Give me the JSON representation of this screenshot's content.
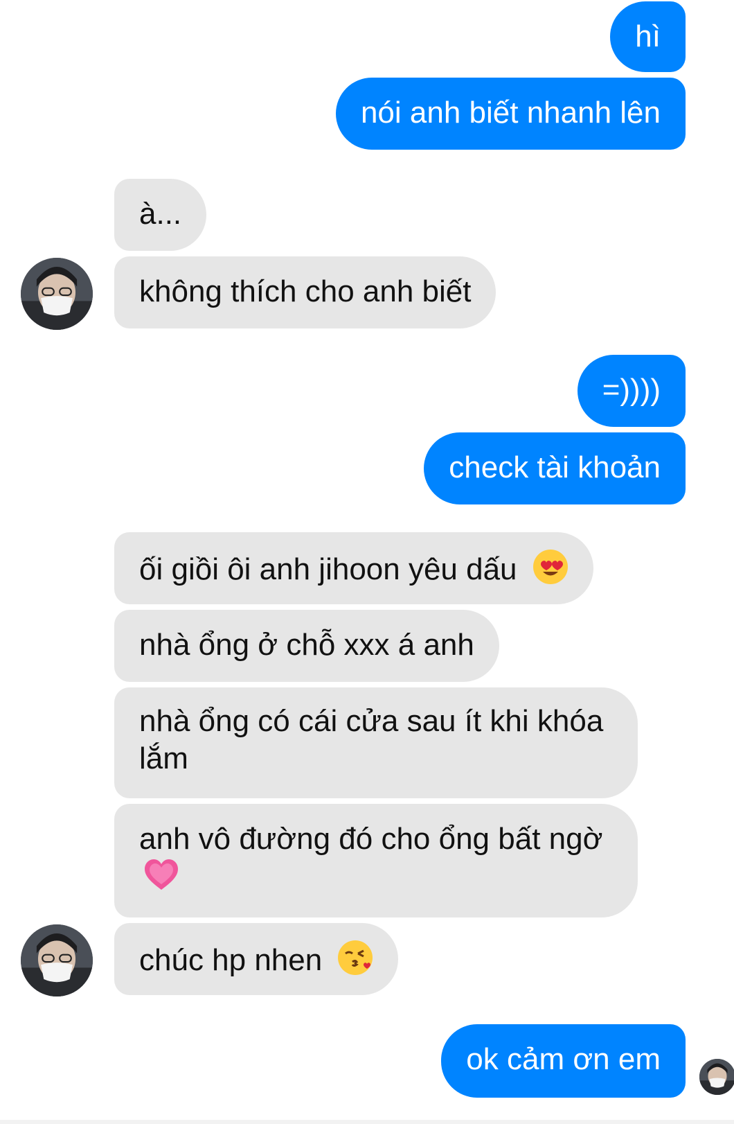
{
  "messages": {
    "m1": "hì",
    "m2": "nói anh biết nhanh lên",
    "m3": "à...",
    "m4": "không thích cho anh biết",
    "m5": "=))))",
    "m6": "check tài khoản",
    "m7": "ối giồi ôi anh jihoon yêu dấu",
    "m8": "nhà ổng ở chỗ xxx á anh",
    "m9": "nhà ổng có cái cửa sau ít khi khóa lắm",
    "m10": "anh vô đường đó cho ổng bất ngờ",
    "m11": "chúc hp nhen",
    "m12": "ok cảm ơn em"
  },
  "icons": {
    "m7": "heart-eyes-emoji",
    "m10": "pink-heart-emoji",
    "m11": "kiss-wink-emoji",
    "contact_avatar": "masked-person-avatar",
    "seen_avatar": "masked-person-avatar"
  },
  "colors": {
    "outgoing_bubble": "#0084ff",
    "incoming_bubble": "#e6e6e6",
    "outgoing_text": "#ffffff",
    "incoming_text": "#111111"
  }
}
